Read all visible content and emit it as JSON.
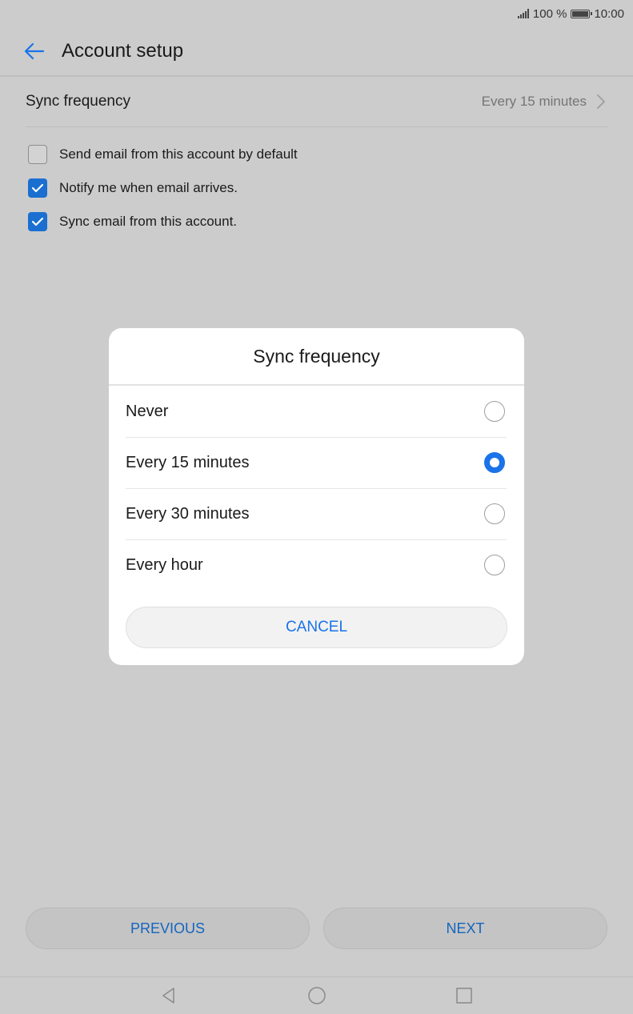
{
  "status_bar": {
    "battery_text": "100 %",
    "time": "10:00"
  },
  "header": {
    "title": "Account setup"
  },
  "settings": {
    "sync_label": "Sync frequency",
    "sync_value": "Every 15 minutes",
    "checkboxes": [
      {
        "label": "Send email from this account by default",
        "checked": false
      },
      {
        "label": "Notify me when email arrives.",
        "checked": true
      },
      {
        "label": "Sync email from this account.",
        "checked": true
      }
    ]
  },
  "footer": {
    "previous_label": "PREVIOUS",
    "next_label": "NEXT"
  },
  "dialog": {
    "title": "Sync frequency",
    "options": [
      {
        "label": "Never",
        "selected": false
      },
      {
        "label": "Every 15 minutes",
        "selected": true
      },
      {
        "label": "Every 30 minutes",
        "selected": false
      },
      {
        "label": "Every hour",
        "selected": false
      }
    ],
    "cancel_label": "CANCEL"
  },
  "colors": {
    "accent": "#1a73e8",
    "checkbox_checked": "#1a6fd1",
    "scrim_background": "#cccccc"
  }
}
